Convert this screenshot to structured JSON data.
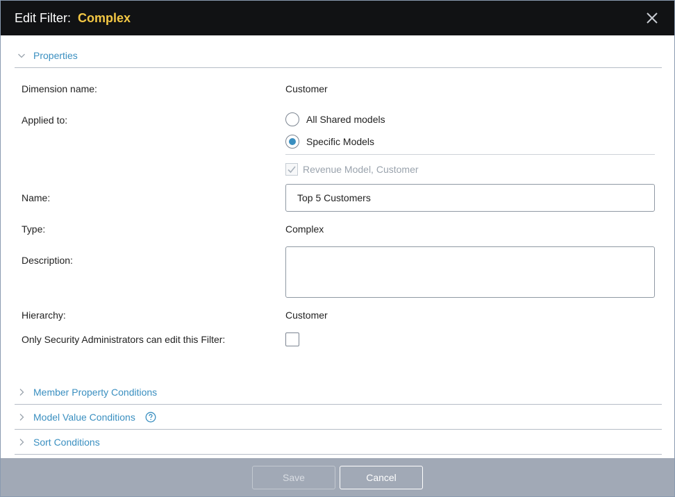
{
  "header": {
    "title_prefix": "Edit Filter:",
    "title_name": "Complex"
  },
  "sections": {
    "properties": "Properties",
    "member_property_conditions": "Member Property Conditions",
    "model_value_conditions": "Model Value Conditions",
    "sort_conditions": "Sort Conditions"
  },
  "properties": {
    "dimension_label": "Dimension name:",
    "dimension_value": "Customer",
    "applied_to_label": "Applied to:",
    "radio_all": "All Shared models",
    "radio_specific": "Specific Models",
    "selected_radio": "Specific Models",
    "model_checkbox": "Revenue Model, Customer",
    "name_label": "Name:",
    "name_value": "Top 5 Customers",
    "type_label": "Type:",
    "type_value": "Complex",
    "description_label": "Description:",
    "description_value": "",
    "hierarchy_label": "Hierarchy:",
    "hierarchy_value": "Customer",
    "security_label": "Only Security Administrators can edit this Filter:"
  },
  "footer": {
    "save": "Save",
    "cancel": "Cancel"
  },
  "colors": {
    "header_bg": "#111214",
    "accent_yellow": "#f3c744",
    "link_blue": "#3a8fc0",
    "footer_bg": "#a1a9b6"
  }
}
